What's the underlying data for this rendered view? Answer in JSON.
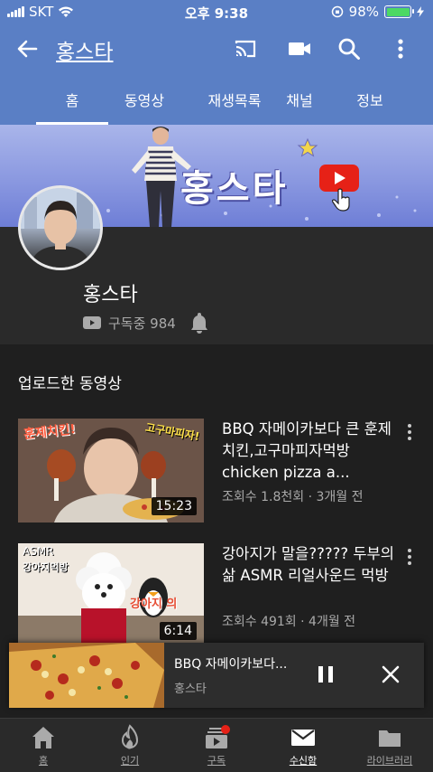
{
  "status_bar": {
    "carrier": "SKT",
    "time": "오후 9:38",
    "battery": "98%"
  },
  "app_bar": {
    "channel_title": "홍스타"
  },
  "tabs": [
    "홈",
    "동영상",
    "재생목록",
    "채널",
    "정보"
  ],
  "active_tab": "홈",
  "banner": {
    "text": "홍스타"
  },
  "channel": {
    "name": "홍스타",
    "subscribers": "구독중 984"
  },
  "section_title": "업로드한 동영상",
  "videos": [
    {
      "title": "BBQ 자메이카보다 큰 훈제치킨,고구마피자먹방  chicken pizza a...",
      "meta": "조회수 1.8천회 · 3개월 전",
      "duration": "15:23",
      "thumb_text_left": "훈제치킨!",
      "thumb_text_right": "고구마피자!"
    },
    {
      "title": "강아지가 말을????? 두부의 삶 ASMR 리얼사운드 먹방",
      "meta": "조회수 491회 · 4개월 전",
      "duration": "6:14",
      "thumb_text_top": "ASMR",
      "thumb_text_sub": "강아지먹방",
      "thumb_text_right": "강아지 의"
    }
  ],
  "mini_player": {
    "title": "BBQ 자메이카보다...",
    "channel": "홍스타"
  },
  "bottom_nav": [
    {
      "label": "홈",
      "icon": "home-icon"
    },
    {
      "label": "인기",
      "icon": "flame-icon"
    },
    {
      "label": "구독",
      "icon": "subscriptions-icon"
    },
    {
      "label": "수신함",
      "icon": "mail-icon"
    },
    {
      "label": "라이브러리",
      "icon": "folder-icon"
    }
  ],
  "colors": {
    "brand_blue": "#5a7fc5",
    "youtube_red": "#e62117",
    "background": "#1f1f1f"
  }
}
